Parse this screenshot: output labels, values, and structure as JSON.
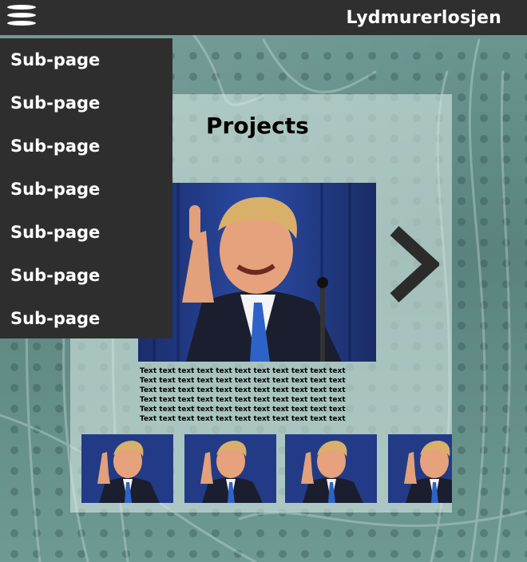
{
  "header": {
    "menu_icon": "hamburger-icon",
    "site_title": "Lydmurerlosjen"
  },
  "menu": {
    "items": [
      {
        "label": "Sub-page"
      },
      {
        "label": "Sub-page"
      },
      {
        "label": "Sub-page"
      },
      {
        "label": "Sub-page"
      },
      {
        "label": "Sub-page"
      },
      {
        "label": "Sub-page"
      },
      {
        "label": "Sub-page"
      }
    ]
  },
  "content": {
    "title": "Projects",
    "main_image": "man-pointing-photo",
    "next_icon": "chevron-right-icon",
    "text_lines": [
      "Text text text text text text text text text text text",
      "Text text text text text text text text text text text",
      "Text text text text text text text text text text text",
      "Text text text text text text text text text text text",
      "Text text text text text text text text text text text",
      "Text text text text text text text text text text text"
    ],
    "thumbnails": [
      {
        "image": "man-pointing-photo"
      },
      {
        "image": "man-pointing-photo"
      },
      {
        "image": "man-pointing-photo"
      },
      {
        "image": "man-pointing-photo"
      }
    ]
  },
  "colors": {
    "bar": "#2f2f2f",
    "menu": "#2e2e2e",
    "panel": "#dcece8",
    "background": "#5f8a84"
  }
}
